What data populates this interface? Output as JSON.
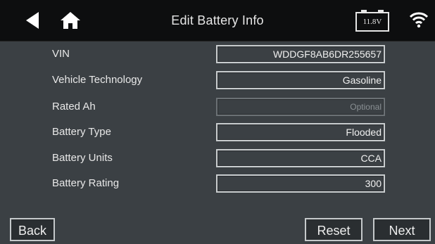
{
  "header": {
    "title": "Edit Battery Info",
    "battery_voltage": "11.8V",
    "back_icon": "back-arrow-icon",
    "home_icon": "home-icon",
    "wifi_icon": "wifi-icon"
  },
  "form": {
    "rows": [
      {
        "label": "VIN",
        "value": "WDDGF8AB6DR255657"
      },
      {
        "label": "Vehicle Technology",
        "value": "Gasoline"
      },
      {
        "label": "Rated Ah",
        "value": "",
        "placeholder": "Optional"
      },
      {
        "label": "Battery Type",
        "value": "Flooded"
      },
      {
        "label": "Battery Units",
        "value": "CCA"
      },
      {
        "label": "Battery Rating",
        "value": "300"
      }
    ]
  },
  "footer": {
    "back_label": "Back",
    "reset_label": "Reset",
    "next_label": "Next"
  },
  "colors": {
    "background": "#3b4044",
    "header": "#0d0e0f",
    "field_border": "#c8ccce",
    "text": "#e8e8e8"
  }
}
